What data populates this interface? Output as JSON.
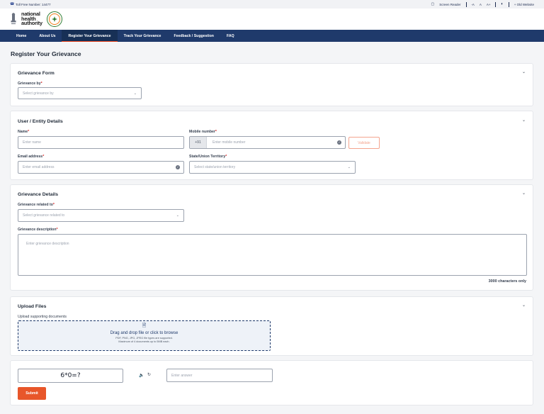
{
  "topbar": {
    "toll_free": "Toll Free Number: 14477",
    "screen_reader": "Screen Reader",
    "font_small": "-A",
    "font_normal": "A",
    "font_large": "A+",
    "old_website": "+ Old Website"
  },
  "header": {
    "logo_line1": "national",
    "logo_line2": "health",
    "logo_line3": "authority"
  },
  "nav": {
    "items": [
      "Home",
      "About Us",
      "Register Your Grievance",
      "Track Your Grievance",
      "Feedback / Suggestion",
      "FAQ"
    ]
  },
  "page": {
    "title": "Register Your Grievance"
  },
  "grievance_form": {
    "title": "Grievance Form",
    "grievance_by_label": "Grievance by",
    "grievance_by_placeholder": "Select grievance by"
  },
  "user_details": {
    "title": "User / Entity Details",
    "name_label": "Name",
    "name_placeholder": "Enter name",
    "mobile_label": "Mobile number",
    "mobile_prefix": "+91",
    "mobile_placeholder": "Enter mobile number",
    "validate_label": "Validate",
    "email_label": "Email address",
    "email_placeholder": "Enter email address",
    "state_label": "State/Union Territory",
    "state_placeholder": "Select state/union territory"
  },
  "grievance_details": {
    "title": "Grievance Details",
    "related_label": "Grievance related to",
    "related_placeholder": "Select grievance related to",
    "description_label": "Grievance description",
    "description_placeholder": "Enter grievance description",
    "counter": "3000 characters only"
  },
  "upload": {
    "title": "Upload Files",
    "label": "Upload supporting documents",
    "drop_text": "Drag and drop file or click to browse",
    "types_text": "PDF, PNG, JPG, JPEG file types are supported.",
    "limit_text": "Maximum of 4 documents up to 5MB each."
  },
  "captcha": {
    "challenge": "6*0=?",
    "answer_placeholder": "Enter answer",
    "submit_label": "Submit"
  },
  "colors": {
    "nav_bg": "#1f3a6b",
    "accent": "#e8562a"
  }
}
